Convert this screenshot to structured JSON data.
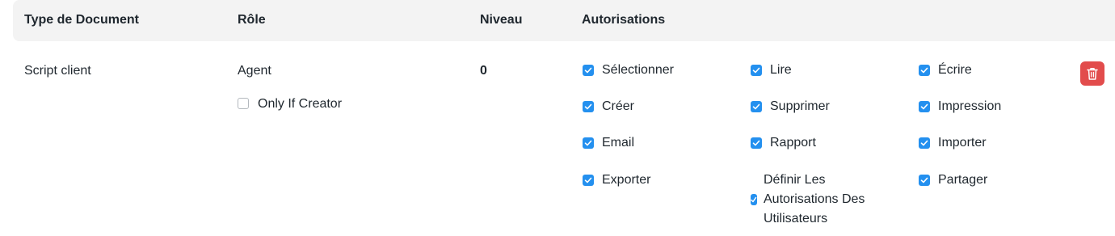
{
  "header": {
    "doctype": "Type de Document",
    "role": "Rôle",
    "level": "Niveau",
    "permissions": "Autorisations"
  },
  "row": {
    "doctype": "Script client",
    "role": "Agent",
    "only_if_creator": {
      "label": "Only If Creator",
      "checked": false
    },
    "level": "0",
    "permissions": [
      {
        "label": "Sélectionner",
        "checked": true
      },
      {
        "label": "Lire",
        "checked": true
      },
      {
        "label": "Écrire",
        "checked": true
      },
      {
        "label": "Créer",
        "checked": true
      },
      {
        "label": "Supprimer",
        "checked": true
      },
      {
        "label": "Impression",
        "checked": true
      },
      {
        "label": "Email",
        "checked": true
      },
      {
        "label": "Rapport",
        "checked": true
      },
      {
        "label": "Importer",
        "checked": true
      },
      {
        "label": "Exporter",
        "checked": true
      },
      {
        "label": "Définir Les Autorisations Des Utilisateurs",
        "label_lines": [
          "Définir Les",
          "Autorisations Des",
          "Utilisateurs"
        ],
        "checked": true
      },
      {
        "label": "Partager",
        "checked": true
      }
    ],
    "delete_icon": "trash-icon"
  },
  "colors": {
    "checkbox": "#2490ef",
    "delete_button": "#e24c4c",
    "header_bg": "#f3f3f3"
  }
}
